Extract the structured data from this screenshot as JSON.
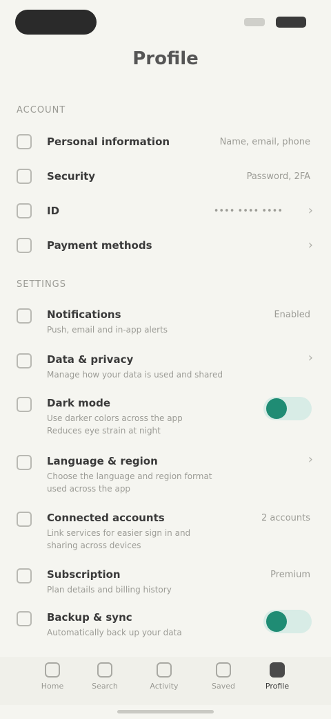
{
  "header": {
    "title": "Profile"
  },
  "sections": [
    {
      "label": "Account"
    },
    {
      "label": "Settings"
    }
  ],
  "account_rows": [
    {
      "title": "Personal information",
      "value": "Name, email, phone"
    },
    {
      "title": "Security",
      "value": "Password, 2FA"
    },
    {
      "title": "ID",
      "value": "•••• •••• ••••"
    },
    {
      "title": "Payment methods",
      "value": ""
    }
  ],
  "settings_rows": [
    {
      "title": "Notifications",
      "subtitle": "Push, email and in-app alerts",
      "value": "Enabled"
    },
    {
      "title": "Data & privacy",
      "subtitle": "Manage how your data is used and shared",
      "value": ""
    },
    {
      "title": "Dark mode",
      "subtitle": "Use darker colors across the app",
      "subtitle2": "Reduces eye strain at night",
      "toggle": true
    },
    {
      "title": "Language & region",
      "subtitle": "Choose the language and region format",
      "subtitle2": "used across the app",
      "value": ""
    },
    {
      "title": "Connected accounts",
      "subtitle": "Link services for easier sign in and",
      "subtitle2": "sharing across devices",
      "value": "2 accounts"
    },
    {
      "title": "Subscription",
      "subtitle": "Plan details and billing history",
      "value": "Premium"
    },
    {
      "title": "Backup & sync",
      "subtitle": "Automatically back up your data",
      "toggle": true
    }
  ],
  "tabs": [
    {
      "label": "Home"
    },
    {
      "label": "Search"
    },
    {
      "label": "Activity"
    },
    {
      "label": "Saved"
    },
    {
      "label": "Profile"
    }
  ],
  "colors": {
    "accent": "#1f8c74",
    "background": "#f5f5f0"
  }
}
